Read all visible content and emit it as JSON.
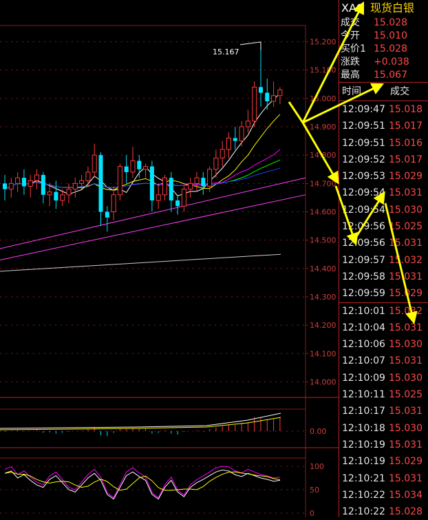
{
  "header": {
    "symbol": "XAG",
    "name": "现货白银"
  },
  "quote": [
    {
      "label": "成交",
      "value": "15.028"
    },
    {
      "label": "今开",
      "value": "15.010"
    },
    {
      "label": "买价1",
      "value": "15.028"
    },
    {
      "label": "涨跌",
      "value": "+0.038"
    },
    {
      "label": "最高",
      "value": "15.067"
    }
  ],
  "ticks_header": {
    "time": "时间",
    "price": "成交"
  },
  "ticks": [
    {
      "time": "12:09:47",
      "price": "15.018"
    },
    {
      "time": "12:09:51",
      "price": "15.017"
    },
    {
      "time": "12:09:51",
      "price": "15.016"
    },
    {
      "time": "12:09:52",
      "price": "15.017"
    },
    {
      "time": "12:09:53",
      "price": "15.029"
    },
    {
      "time": "12:09:54",
      "price": "15.031"
    },
    {
      "time": "12:09:54",
      "price": "15.030"
    },
    {
      "time": "12:09:56",
      "price": "15.025"
    },
    {
      "time": "12:09:56",
      "price": "15.031"
    },
    {
      "time": "12:09:57",
      "price": "15.032"
    },
    {
      "time": "12:09:58",
      "price": "15.031"
    },
    {
      "time": "12:09:59",
      "price": "15.029"
    },
    {
      "time": "12:10:01",
      "price": "15.032"
    },
    {
      "time": "12:10:04",
      "price": "15.031"
    },
    {
      "time": "12:10:06",
      "price": "15.030"
    },
    {
      "time": "12:10:07",
      "price": "15.031"
    },
    {
      "time": "12:10:09",
      "price": "15.030"
    },
    {
      "time": "12:10:11",
      "price": "15.025"
    },
    {
      "time": "12:10:17",
      "price": "15.031"
    },
    {
      "time": "12:10:18",
      "price": "15.030"
    },
    {
      "time": "12:10:19",
      "price": "15.031"
    },
    {
      "time": "12:10:19",
      "price": "15.029"
    },
    {
      "time": "12:10:21",
      "price": "15.031"
    },
    {
      "time": "12:10:22",
      "price": "15.034"
    },
    {
      "time": "12:10:22",
      "price": "15.028"
    }
  ],
  "chart": {
    "price_axis_labels": [
      "15.200",
      "15.100",
      "15.000",
      "14.900",
      "14.800",
      "14.700",
      "14.600",
      "14.500",
      "14.400",
      "14.300",
      "14.200",
      "14.100",
      "14.000"
    ],
    "high_marker": "15.167",
    "macd_axis_label": "0.00",
    "kdj_axis_labels": [
      "100",
      "50",
      "0"
    ],
    "colors": {
      "up": "#ff3b3b",
      "down": "#00e5ff",
      "grid": "#8b1a1a",
      "axis_text": "#d23c3c"
    }
  },
  "chart_data": {
    "type": "candlestick",
    "ylim": [
      13.95,
      15.25
    ],
    "candles": [
      {
        "o": 14.7,
        "h": 14.73,
        "c": 14.68,
        "l": 14.64
      },
      {
        "o": 14.68,
        "h": 14.72,
        "c": 14.7,
        "l": 14.65
      },
      {
        "o": 14.7,
        "h": 14.74,
        "c": 14.72,
        "l": 14.67
      },
      {
        "o": 14.72,
        "h": 14.75,
        "c": 14.69,
        "l": 14.66
      },
      {
        "o": 14.69,
        "h": 14.73,
        "c": 14.71,
        "l": 14.65
      },
      {
        "o": 14.71,
        "h": 14.75,
        "c": 14.73,
        "l": 14.68
      },
      {
        "o": 14.73,
        "h": 14.74,
        "c": 14.66,
        "l": 14.63
      },
      {
        "o": 14.66,
        "h": 14.7,
        "c": 14.67,
        "l": 14.62
      },
      {
        "o": 14.67,
        "h": 14.71,
        "c": 14.64,
        "l": 14.61
      },
      {
        "o": 14.64,
        "h": 14.68,
        "c": 14.66,
        "l": 14.62
      },
      {
        "o": 14.66,
        "h": 14.7,
        "c": 14.68,
        "l": 14.63
      },
      {
        "o": 14.68,
        "h": 14.72,
        "c": 14.7,
        "l": 14.65
      },
      {
        "o": 14.7,
        "h": 14.73,
        "c": 14.71,
        "l": 14.68
      },
      {
        "o": 14.71,
        "h": 14.76,
        "c": 14.74,
        "l": 14.69
      },
      {
        "o": 14.74,
        "h": 14.84,
        "c": 14.8,
        "l": 14.72
      },
      {
        "o": 14.8,
        "h": 14.81,
        "c": 14.6,
        "l": 14.55
      },
      {
        "o": 14.6,
        "h": 14.62,
        "c": 14.58,
        "l": 14.53
      },
      {
        "o": 14.6,
        "h": 14.69,
        "c": 14.66,
        "l": 14.57
      },
      {
        "o": 14.66,
        "h": 14.77,
        "c": 14.76,
        "l": 14.64
      },
      {
        "o": 14.76,
        "h": 14.8,
        "c": 14.74,
        "l": 14.7
      },
      {
        "o": 14.74,
        "h": 14.83,
        "c": 14.78,
        "l": 14.72
      },
      {
        "o": 14.78,
        "h": 14.8,
        "c": 14.75,
        "l": 14.72
      },
      {
        "o": 14.75,
        "h": 14.77,
        "c": 14.76,
        "l": 14.72
      },
      {
        "o": 14.76,
        "h": 14.78,
        "c": 14.64,
        "l": 14.6
      },
      {
        "o": 14.64,
        "h": 14.7,
        "c": 14.66,
        "l": 14.61
      },
      {
        "o": 14.66,
        "h": 14.73,
        "c": 14.72,
        "l": 14.64
      },
      {
        "o": 14.72,
        "h": 14.74,
        "c": 14.64,
        "l": 14.6
      },
      {
        "o": 14.64,
        "h": 14.66,
        "c": 14.62,
        "l": 14.59
      },
      {
        "o": 14.62,
        "h": 14.69,
        "c": 14.68,
        "l": 14.6
      },
      {
        "o": 14.68,
        "h": 14.72,
        "c": 14.7,
        "l": 14.65
      },
      {
        "o": 14.7,
        "h": 14.74,
        "c": 14.72,
        "l": 14.67
      },
      {
        "o": 14.72,
        "h": 14.74,
        "c": 14.69,
        "l": 14.66
      },
      {
        "o": 14.69,
        "h": 14.76,
        "c": 14.75,
        "l": 14.67
      },
      {
        "o": 14.75,
        "h": 14.82,
        "c": 14.79,
        "l": 14.72
      },
      {
        "o": 14.79,
        "h": 14.85,
        "c": 14.82,
        "l": 14.76
      },
      {
        "o": 14.82,
        "h": 14.88,
        "c": 14.86,
        "l": 14.79
      },
      {
        "o": 14.86,
        "h": 14.9,
        "c": 14.85,
        "l": 14.82
      },
      {
        "o": 14.85,
        "h": 14.92,
        "c": 14.9,
        "l": 14.83
      },
      {
        "o": 14.9,
        "h": 14.96,
        "c": 14.92,
        "l": 14.88
      },
      {
        "o": 14.92,
        "h": 15.06,
        "c": 15.04,
        "l": 14.9
      },
      {
        "o": 15.04,
        "h": 15.17,
        "c": 15.02,
        "l": 14.97
      },
      {
        "o": 15.02,
        "h": 15.07,
        "c": 14.99,
        "l": 14.96
      },
      {
        "o": 14.99,
        "h": 15.06,
        "c": 15.01,
        "l": 14.97
      },
      {
        "o": 15.01,
        "h": 15.04,
        "c": 15.03,
        "l": 14.98
      }
    ]
  }
}
